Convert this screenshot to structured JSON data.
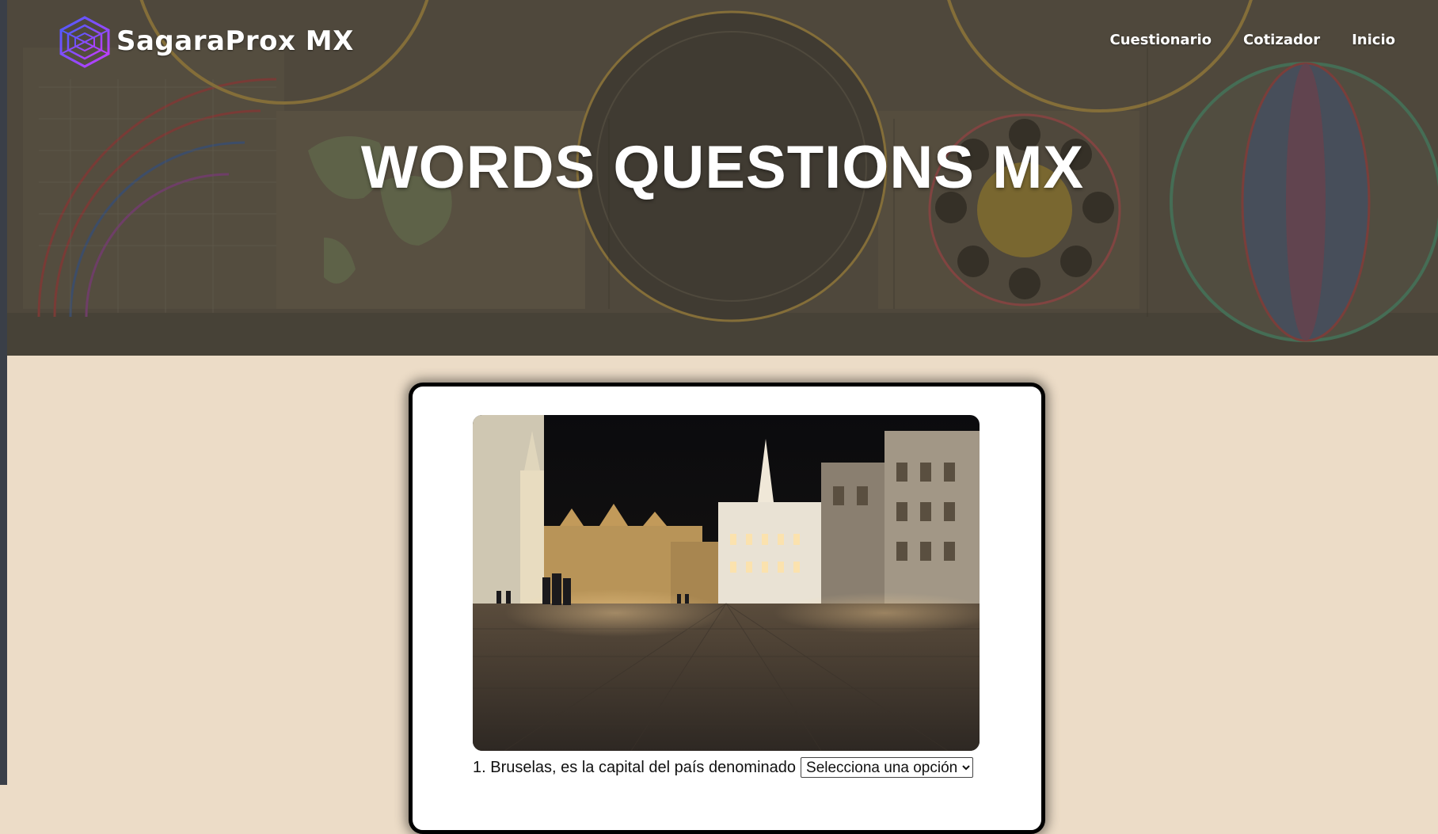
{
  "header": {
    "brand_name": "SagaraProx MX",
    "logo_icon": "web-globe-icon",
    "nav": [
      {
        "label": "Cuestionario"
      },
      {
        "label": "Cotizador"
      },
      {
        "label": "Inicio"
      }
    ],
    "hero_title": "WORDS QUESTIONS MX"
  },
  "quiz": {
    "image_icon": "brussels-grand-place-photo",
    "questions": [
      {
        "text": "1. Bruselas, es la capital del país denominado",
        "selected_option": "Selecciona una opción"
      }
    ]
  },
  "colors": {
    "page_background": "#ecdcc7",
    "card_border": "#000000",
    "logo_accent": "#7a3cff"
  }
}
